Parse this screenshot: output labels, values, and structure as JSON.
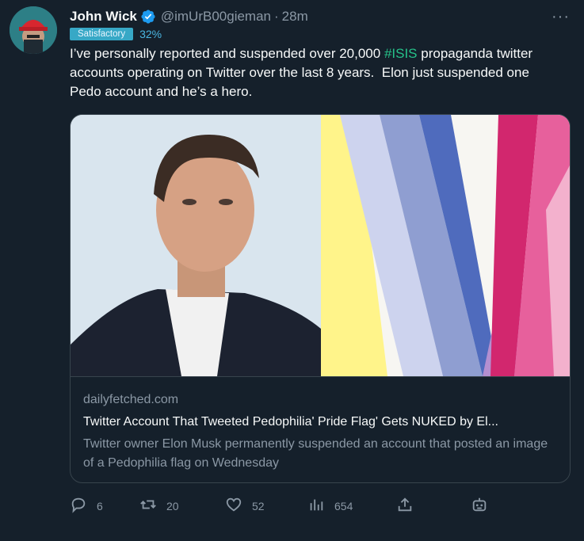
{
  "tweet": {
    "display_name": "John Wick",
    "handle": "@imUrB00gieman",
    "separator": "·",
    "time": "28m",
    "badge_label": "Satisfactory",
    "badge_percent": "32%",
    "text_before": "I’ve personally reported and suspended over 20,000 ",
    "hashtag": "#ISIS",
    "text_after": " propaganda twitter accounts operating on Twitter over the last 8 years.  Elon just suspended one Pedo account and he’s a hero.",
    "more_label": "···"
  },
  "card": {
    "domain": "dailyfetched.com",
    "title": "Twitter Account That Tweeted Pedophilia' Pride Flag' Gets NUKED by El...",
    "description": "Twitter owner Elon Musk permanently suspended an account that posted an image of a Pedophilia flag on Wednesday"
  },
  "actions": {
    "replies": "6",
    "retweets": "20",
    "likes": "52",
    "views": "654"
  },
  "icons": [
    "avatar",
    "verified-badge-icon",
    "more-icon",
    "reply-icon",
    "retweet-icon",
    "like-icon",
    "views-icon",
    "share-icon",
    "bot-icon"
  ],
  "colors": {
    "background": "#15202b",
    "accent": "#1d9bf0",
    "muted": "#8b98a5"
  }
}
